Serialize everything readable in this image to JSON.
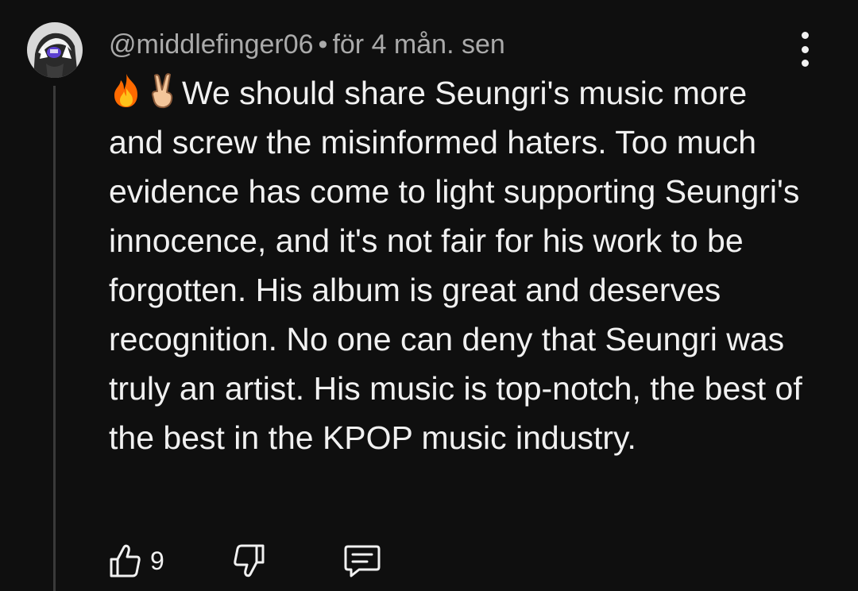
{
  "comment": {
    "author": "@middlefinger06",
    "separator": "•",
    "time": "för 4 mån. sen",
    "text": "We should share Seungri's music more and screw the misinformed haters. Too much evidence has come to light supporting Seungri's innocence, and it's not fair for his work to be forgotten. His album is great and deserves recognition. No one can deny that Seungri was truly an artist. His music is top-notch, the best of the best in the KPOP music industry.",
    "leading_emoji": [
      "fire-emoji",
      "victory-hand-emoji"
    ],
    "likes": "9"
  },
  "icons": {
    "menu": "more-vertical-icon",
    "like": "thumbs-up-icon",
    "dislike": "thumbs-down-icon",
    "reply": "reply-comment-icon"
  },
  "colors": {
    "background": "#0f0f0f",
    "text": "#f1f1f1",
    "meta": "#aaaaaa",
    "thread_line": "#3a3a3a"
  }
}
